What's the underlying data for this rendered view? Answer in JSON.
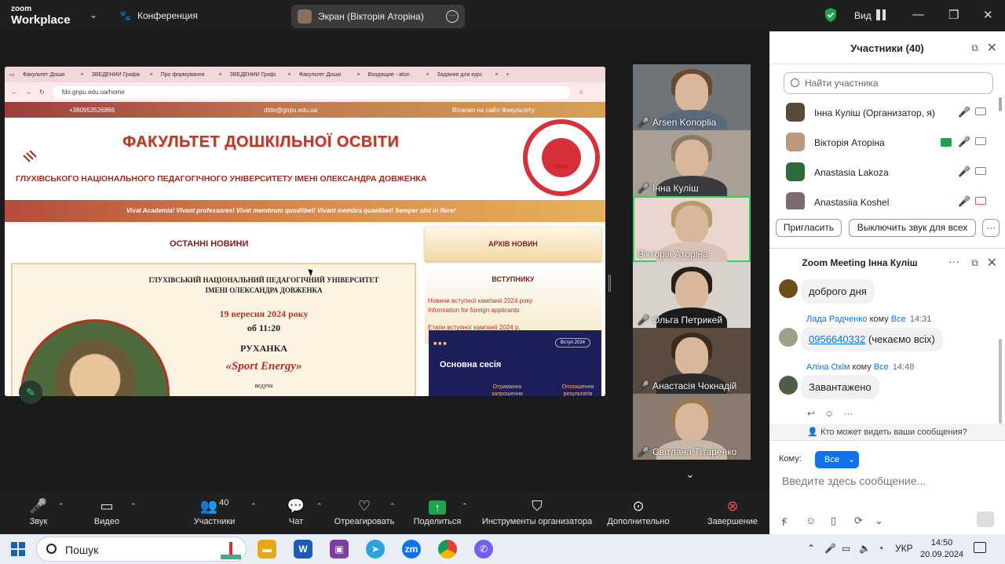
{
  "titlebar": {
    "brand_line1": "zoom",
    "brand_line2": "Workplace",
    "meeting_label": "Конференция",
    "share_pill": "Экран (Вікторія Аторіна)",
    "view_label": "Вид"
  },
  "shared_screen": {
    "browser_tabs": [
      "Факультет Дошкі",
      "ЗВЕДЕНИЙ Графік",
      "Про формування",
      "ЗВЕДЕНИЙ Графі",
      "Факультет Дошкі",
      "Входящие - atori",
      "Задание для курс"
    ],
    "url": "fdo.gnpu.edu.ua/home",
    "phone": "+380953526866",
    "email": "dfdo@gnpu.edu.ua",
    "welcome": "Вітаємо на сайті Факультету",
    "site_title": "ФАКУЛЬТЕТ ДОШКІЛЬНОЇ ОСВІТИ",
    "site_subtitle": "ГЛУХІВСЬКОГО НАЦІОНАЛЬНОГО ПЕДАГОГІЧНОГО УНІВЕРСИТЕТУ ІМЕНІ ОЛЕКСАНДРА ДОВЖЕНКА",
    "seal_text": "ФАКУЛЬТЕТ ДОШКІЛЬНОЇ ОСВІТИ",
    "seal_bottom": "ГНПУ",
    "motto": "Vivat Academia! Vivant professores! Vivat membrum quodlibet! Vivant membra quaelibet! Semper sint in flore!",
    "news_heading": "ОСТАННІ НОВИНИ",
    "archive_label": "АРХІВ НОВИН",
    "poster": {
      "uni": "ГЛУХІВСЬКИЙ НАЦІОНАЛЬНИЙ ПЕДАГОГІЧНИЙ УНІВЕРСИТЕТ ІМЕНІ ОЛЕКСАНДРА ДОВЖЕНКА",
      "date": "19 вересня 2024 року",
      "time": "об 11:20",
      "event": "РУХАНКА",
      "event_name": "«Sport Energy»",
      "host": "ведуча"
    },
    "admission": {
      "heading": "ВСТУПНИКУ",
      "links": [
        "Новини вступної кампанії 2024 року",
        "Information for foreign applicants",
        "Етапи вступної кампанії 2024 р."
      ]
    },
    "session": {
      "tag": "Вступ 2024",
      "title": "Основна сесія",
      "left": "Отримання запрошення",
      "right": "Оголошення результатів"
    }
  },
  "gallery": [
    {
      "name": "Arsen Konoplia",
      "muted": true,
      "active": false
    },
    {
      "name": "Інна Куліш",
      "muted": true,
      "active": false
    },
    {
      "name": "Вікторія Аторіна",
      "muted": false,
      "active": true
    },
    {
      "name": "Ольга Петрикей",
      "muted": true,
      "active": false
    },
    {
      "name": "Анастасія Чокнадій",
      "muted": true,
      "active": false
    },
    {
      "name": "Світлана Тітаренко",
      "muted": true,
      "active": false
    }
  ],
  "participants": {
    "title": "Участники (40)",
    "search_placeholder": "Найти участника",
    "list": [
      {
        "name": "Інна Куліш (Организатор, я)"
      },
      {
        "name": "Вікторія Аторіна"
      },
      {
        "name": "Anastasia Lakoza"
      },
      {
        "name": "Anastasiia Koshel"
      }
    ],
    "invite_label": "Пригласить",
    "mute_all_label": "Выключить звук для всех",
    "more_label": "···"
  },
  "chat": {
    "title": "Zoom Meeting Інна Куліш",
    "messages": [
      {
        "text": "доброго дня"
      },
      {
        "author": "Лада Радченко",
        "to_word": "кому",
        "to": "Все",
        "time": "14:31",
        "phone": "0956640332",
        "text": "(чекаємо всіх)"
      },
      {
        "author": "Аліна Охім",
        "to_word": "кому",
        "to": "Все",
        "time": "14:48",
        "text": "Завантажено"
      }
    ],
    "who_sees": "Кто может видеть ваши сообщения?",
    "to_label": "Кому:",
    "to_value": "Все",
    "input_placeholder": "Введите здесь сообщение..."
  },
  "toolbar": {
    "mute": "Звук",
    "video": "Видео",
    "participants": "Участники",
    "participants_count": "40",
    "chat": "Чат",
    "react": "Отреагировать",
    "share": "Поделиться",
    "host_tools": "Инструменты организатора",
    "more": "Дополнительно",
    "end": "Завершение"
  },
  "taskbar": {
    "search_label": "Пошук",
    "language": "УКР",
    "time": "14:50",
    "date": "20.09.2024"
  },
  "colors": {
    "accent": "#0e72ed",
    "active_speaker": "#2ed35d",
    "site_red": "#b73b2a"
  }
}
